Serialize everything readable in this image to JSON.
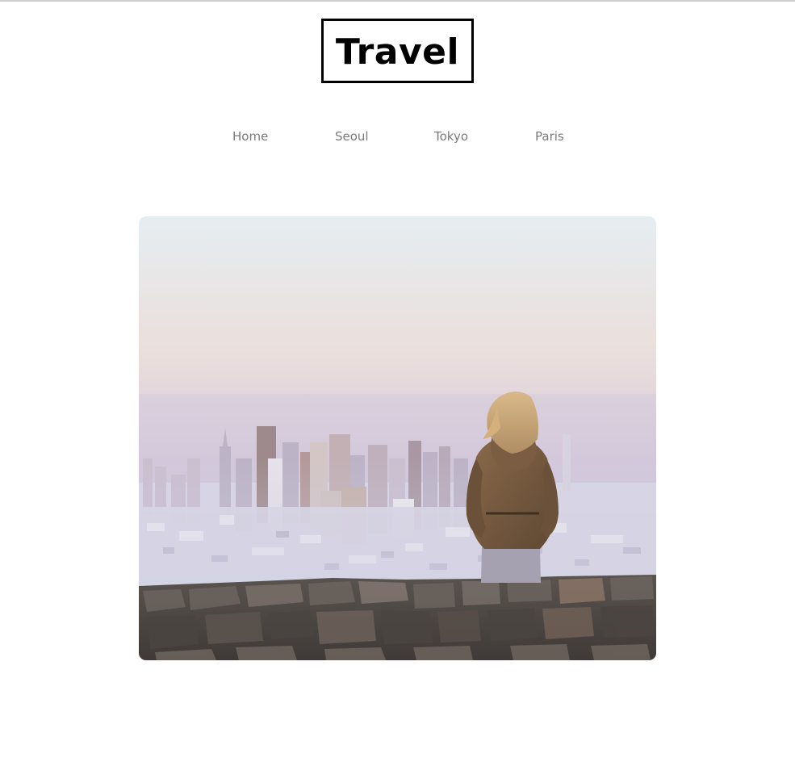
{
  "site": {
    "logo_text": "Travel"
  },
  "nav": {
    "items": [
      {
        "label": "Home"
      },
      {
        "label": "Seoul"
      },
      {
        "label": "Tokyo"
      },
      {
        "label": "Paris"
      }
    ]
  },
  "hero": {
    "image_description_icon": "city-overlook-photo"
  },
  "colors": {
    "nav_text": "#7a7a7a",
    "logo_border": "#000000",
    "background": "#ffffff"
  }
}
